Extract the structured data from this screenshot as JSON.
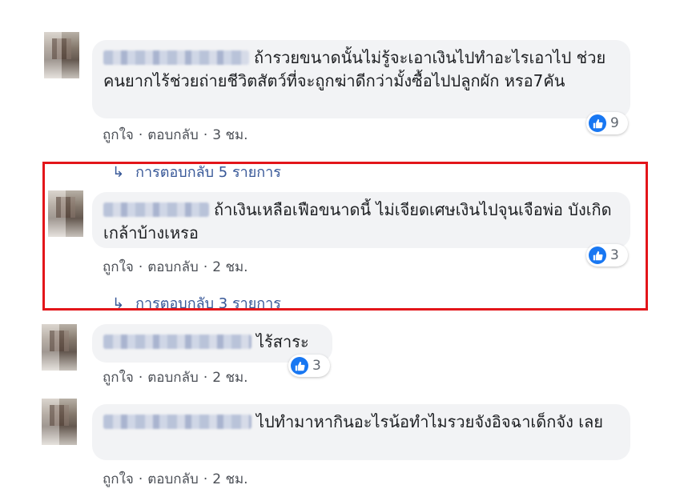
{
  "comments": [
    {
      "text": "ถ้ารวยขนาดนั้นไม่รู้จะเอาเงินไปทำอะไรเอาไป ช่วยคนยากไร้ช่วยถ่ายชีวิตสัตว์ที่จะถูกฆ่าดีกว่ามั้งซื้อไปปลูกผัก หรอ7คัน",
      "like": "ถูกใจ",
      "reply": "ตอบกลับ",
      "time": "3 ชม.",
      "reactions": "9",
      "replies": "การตอบกลับ 5 รายการ"
    },
    {
      "text": "ถ้าเงินเหลือเฟือขนาดนี้ ไม่เจียดเศษเงินไปจุนเจือพ่อ บังเกิดเกล้าบ้างเหรอ",
      "like": "ถูกใจ",
      "reply": "ตอบกลับ",
      "time": "2 ชม.",
      "reactions": "3",
      "replies": "การตอบกลับ 3 รายการ"
    },
    {
      "text": "ไร้สาระ",
      "like": "ถูกใจ",
      "reply": "ตอบกลับ",
      "time": "2 ชม.",
      "reactions": "3"
    },
    {
      "text": "ไปทำมาหากินอะไรน้อทำไมรวยจังอิจฉาเด็กจัง เลย",
      "like": "ถูกใจ",
      "reply": "ตอบกลับ",
      "time": "2 ชม."
    }
  ],
  "meta_separator": "·",
  "reply_arrow_icon": "reply-arrow-icon",
  "like_icon": "thumbs-up-icon",
  "colors": {
    "bubble": "#f2f3f5",
    "link": "#385898",
    "like_badge": "#1877f2",
    "highlight_border": "#e3151a"
  }
}
